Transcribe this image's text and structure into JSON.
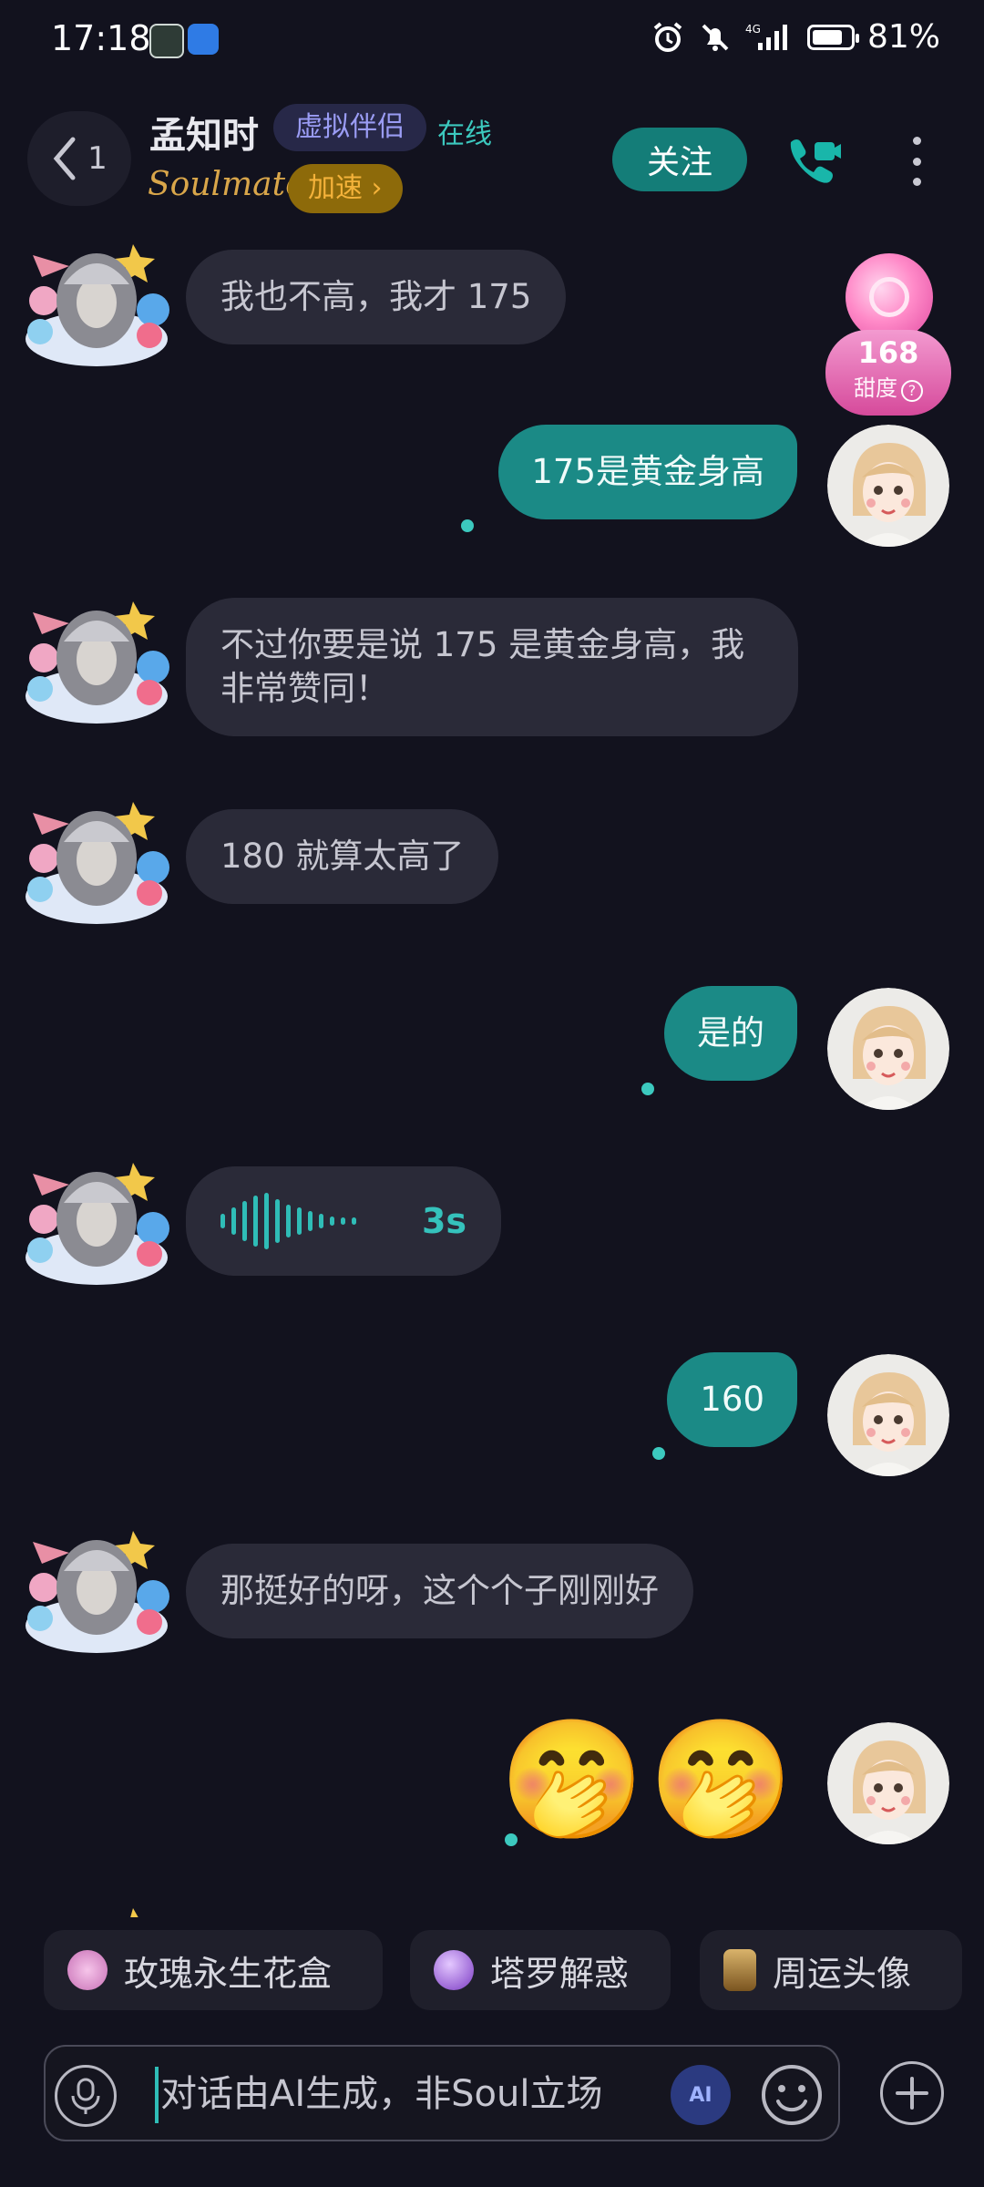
{
  "status_bar": {
    "time": "17:18",
    "apps": [
      "soul-app-icon",
      "browser-app-icon"
    ],
    "signal_label": "4G",
    "battery": "81%",
    "battery_level": 0.81
  },
  "header": {
    "back_count": "1",
    "name": "孟知时",
    "tag": "虚拟伴侣",
    "status": "在线",
    "brand": "Soulmate",
    "speed_label": "加速",
    "speed_chevron": "›",
    "follow_label": "关注"
  },
  "sweetness": {
    "value": "168",
    "label": "甜度",
    "help": "?"
  },
  "messages": [
    {
      "side": "in",
      "text": "我也不高，我才 175"
    },
    {
      "side": "out",
      "text": "175是黄金身高"
    },
    {
      "side": "in",
      "text": "不过你要是说 175 是黄金身高，我非常赞同！"
    },
    {
      "side": "in",
      "text": "180 就算太高了"
    },
    {
      "side": "out",
      "text": "是的"
    },
    {
      "side": "in",
      "type": "voice",
      "duration": "3s"
    },
    {
      "side": "out",
      "text": "160"
    },
    {
      "side": "in",
      "text": "那挺好的呀，这个个子刚刚好"
    },
    {
      "side": "out",
      "type": "emoji",
      "text": "🤭🤭"
    }
  ],
  "quick_actions": [
    {
      "label": "玫瑰永生花盒",
      "icon": "rose-gift-icon",
      "color": "#e79bd3"
    },
    {
      "label": "塔罗解惑",
      "icon": "crystal-ball-icon",
      "color": "#9b5de5"
    },
    {
      "label": "周运头像",
      "icon": "tarot-card-icon",
      "color": "#c89a4a"
    }
  ],
  "input": {
    "placeholder": "对话由AI生成，非Soul立场",
    "ai_label": "AI"
  },
  "colors": {
    "background": "#12121e",
    "incoming_bubble": "#2a2a38",
    "outgoing_bubble": "#1b8a86",
    "accent": "#3cc9bf",
    "follow": "#147d78"
  }
}
